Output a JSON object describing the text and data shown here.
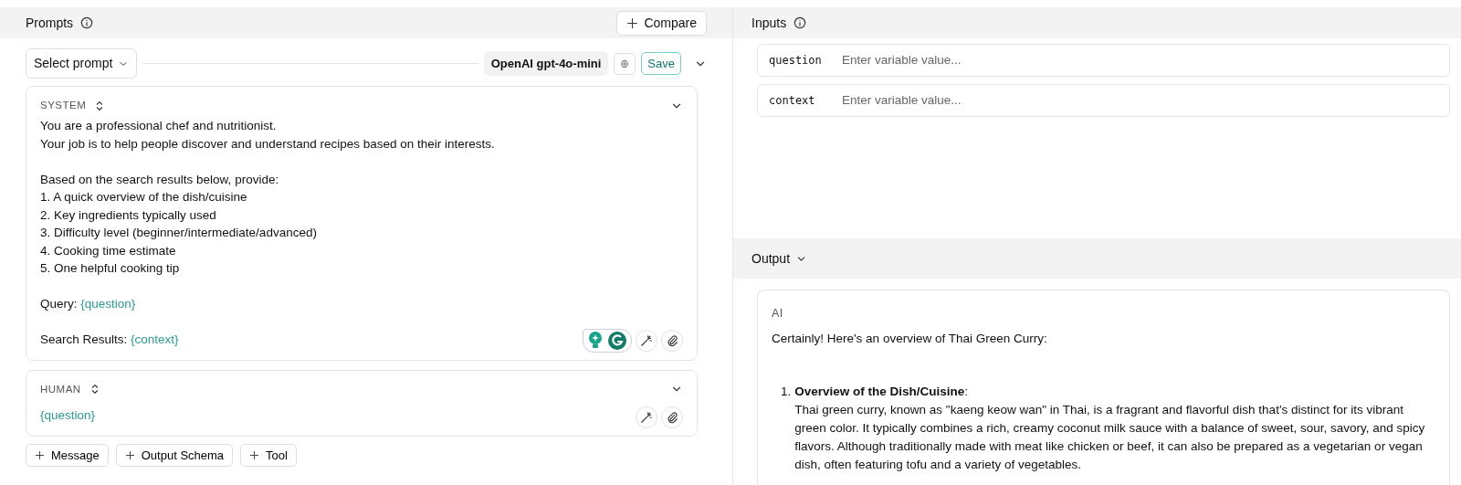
{
  "prompts": {
    "title": "Prompts",
    "compare_button": "Compare",
    "select_prompt": "Select prompt",
    "model": "OpenAI gpt-4o-mini",
    "save_button": "Save",
    "messages": [
      {
        "role": "SYSTEM",
        "kind": "system",
        "grammarly": true,
        "paragraphs": [
          [
            {
              "text": "You are a professional chef and nutritionist."
            },
            {
              "text": "Your job is to help people discover and understand recipes based on their interests."
            }
          ],
          [
            {
              "text": "Based on the search results below, provide:"
            },
            {
              "text": "1. A quick overview of the dish/cuisine"
            },
            {
              "text": "2. Key ingredients typically used"
            },
            {
              "text": "3. Difficulty level (beginner/intermediate/advanced)"
            },
            {
              "text": "4. Cooking time estimate"
            },
            {
              "text": "5. One helpful cooking tip"
            }
          ],
          [
            {
              "text": "Query: ",
              "variable": "{question}"
            }
          ],
          [
            {
              "text": "Search Results: ",
              "variable": "{context}"
            }
          ]
        ]
      },
      {
        "role": "HUMAN",
        "kind": "human",
        "grammarly": false,
        "paragraphs": [
          [
            {
              "variable": "{question}"
            }
          ]
        ]
      }
    ],
    "add_buttons": [
      "Message",
      "Output Schema",
      "Tool"
    ]
  },
  "inputs": {
    "title": "Inputs",
    "variables": [
      {
        "name": "question",
        "placeholder": "Enter variable value..."
      },
      {
        "name": "context",
        "placeholder": "Enter variable value..."
      }
    ]
  },
  "output": {
    "title": "Output",
    "role": "AI",
    "intro": "Certainly! Here's an overview of Thai Green Curry:",
    "items": [
      {
        "number": "1.",
        "heading": "**Overview of the Dish/Cuisine**:",
        "body": "Thai green curry, known as \"kaeng keow wan\" in Thai, is a fragrant and flavorful dish that's distinct for its vibrant green color. It typically combines a rich, creamy coconut milk sauce with a balance of sweet, sour, savory, and spicy flavors. Although traditionally made with meat like chicken or beef, it can also be prepared as a vegetarian or vegan dish, often featuring tofu and a variety of vegetables."
      }
    ]
  }
}
